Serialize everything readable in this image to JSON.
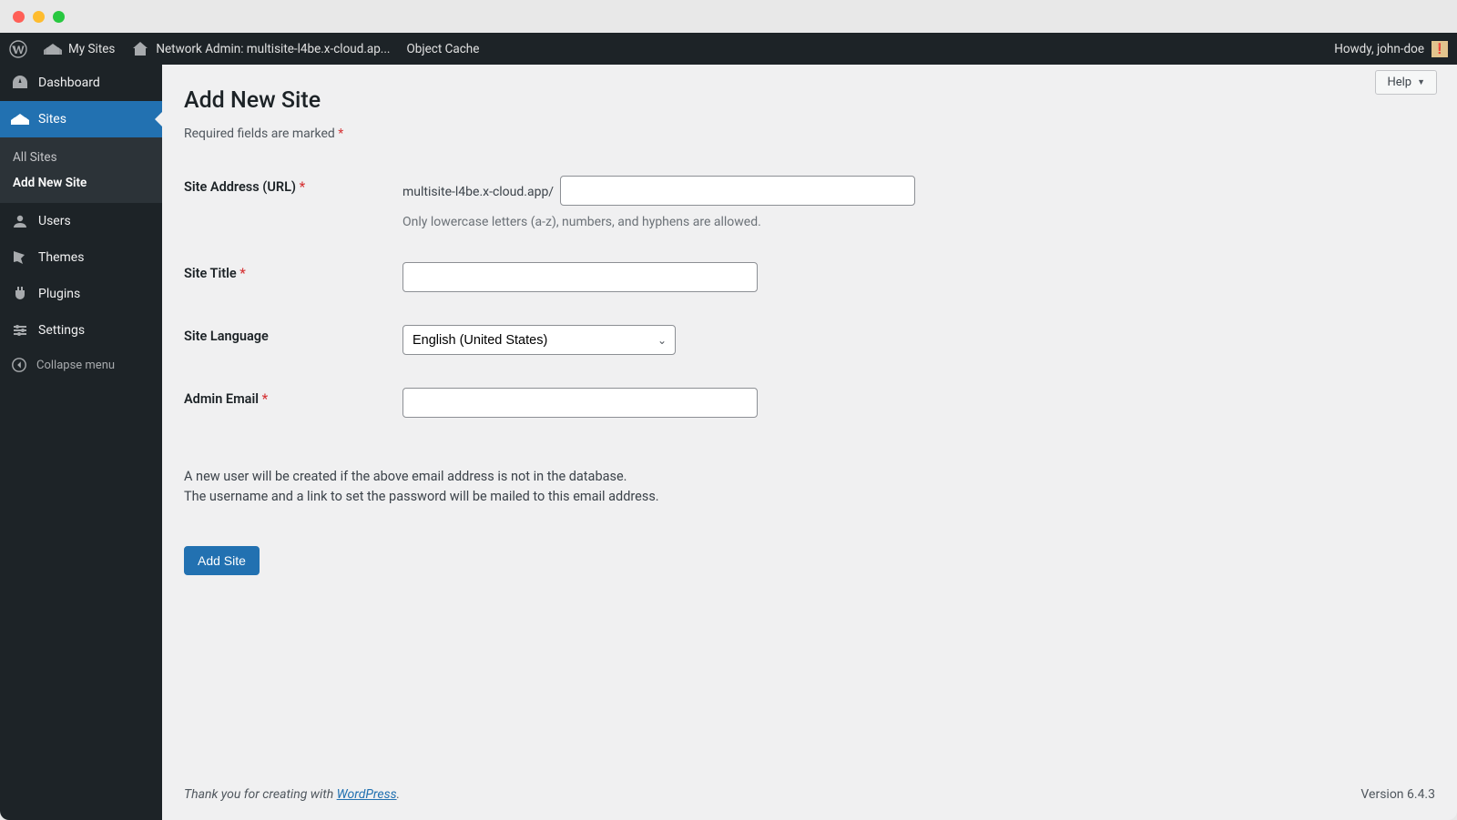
{
  "adminbar": {
    "mysites": "My Sites",
    "network_admin": "Network Admin: multisite-l4be.x-cloud.ap...",
    "object_cache": "Object Cache",
    "howdy": "Howdy, john-doe",
    "avatar_glyph": "❗"
  },
  "sidebar": {
    "dashboard": "Dashboard",
    "sites": "Sites",
    "sites_sub": {
      "all_sites": "All Sites",
      "add_new": "Add New Site"
    },
    "users": "Users",
    "themes": "Themes",
    "plugins": "Plugins",
    "settings": "Settings",
    "collapse": "Collapse menu"
  },
  "page": {
    "help": "Help",
    "title": "Add New Site",
    "required_note": "Required fields are marked",
    "required_star": "*"
  },
  "form": {
    "site_address": {
      "label": "Site Address (URL)",
      "prefix": "multisite-l4be.x-cloud.app/",
      "value": "",
      "hint": "Only lowercase letters (a-z), numbers, and hyphens are allowed."
    },
    "site_title": {
      "label": "Site Title",
      "value": ""
    },
    "site_language": {
      "label": "Site Language",
      "selected": "English (United States)"
    },
    "admin_email": {
      "label": "Admin Email",
      "value": ""
    },
    "info_line1": "A new user will be created if the above email address is not in the database.",
    "info_line2": "The username and a link to set the password will be mailed to this email address.",
    "submit": "Add Site"
  },
  "footer": {
    "thanks_prefix": "Thank you for creating with ",
    "wp_link": "WordPress",
    "thanks_suffix": ".",
    "version": "Version 6.4.3"
  }
}
